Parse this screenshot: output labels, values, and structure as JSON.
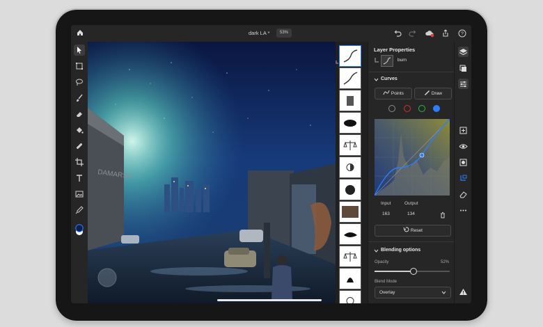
{
  "topbar": {
    "doc_title": "dark LA *",
    "zoom": "53%",
    "icons": [
      "home-icon",
      "undo-icon",
      "redo-icon",
      "cloud-sync-icon",
      "share-icon",
      "help-icon"
    ]
  },
  "toolbar": {
    "tools": [
      "select-tool",
      "transform-tool",
      "lasso-tool",
      "brush-tool",
      "eraser-tool",
      "fill-tool",
      "healing-tool",
      "crop-tool",
      "type-tool",
      "place-image-tool",
      "eyedropper-tool",
      "color-swatch"
    ]
  },
  "canvas": {
    "graffiti_text": "DAMARSH"
  },
  "layers_strip": {
    "count": 14,
    "selected_index": 0
  },
  "panel": {
    "title": "Layer Properties",
    "layer_name": "burn",
    "curves": {
      "section": "Curves",
      "points_label": "Points",
      "draw_label": "Draw",
      "channel_colors": [
        "#888888",
        "#d23232",
        "#31b544",
        "#2c7ef8"
      ],
      "input_label": "Input",
      "output_label": "Output",
      "input_value": "163",
      "output_value": "134",
      "reset_label": "Reset"
    },
    "blending": {
      "section": "Blending options",
      "opacity_label": "Opacity",
      "opacity_value": "52%",
      "opacity": 0.52,
      "mode_label": "Blend Mode",
      "mode_value": "Overlay"
    }
  },
  "right_tools": [
    "layers-icon",
    "adjustments-icon",
    "properties-icon",
    "add-layer-icon",
    "visibility-icon",
    "mask-icon",
    "clipping-icon",
    "eraser-icon",
    "more-icon",
    "warning-icon"
  ]
}
